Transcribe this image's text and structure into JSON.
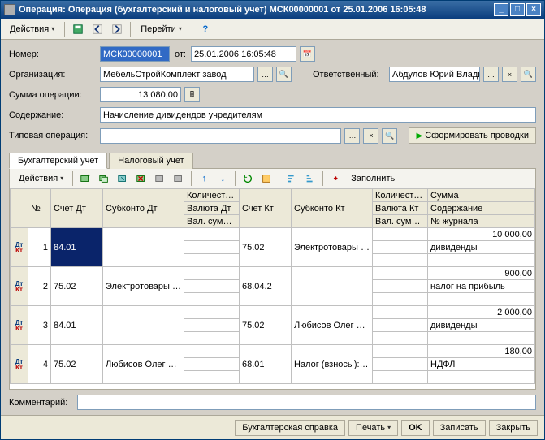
{
  "title": "Операция: Операция (бухгалтерский и налоговый учет) МСК00000001 от 25.01.2006 16:05:48",
  "toolbar": {
    "actions": "Действия",
    "goto": "Перейти",
    "help": "?"
  },
  "fields": {
    "number_label": "Номер:",
    "number_value": "МСК00000001",
    "from_label": "от:",
    "date_value": "25.01.2006 16:05:48",
    "org_label": "Организация:",
    "org_value": "МебельСтройКомплект завод",
    "resp_label": "Ответственный:",
    "resp_value": "Абдулов Юрий Владимирович",
    "sum_label": "Сумма операции:",
    "sum_value": "13 080,00",
    "content_label": "Содержание:",
    "content_value": "Начисление дивидендов учредителям",
    "typical_label": "Типовая операция:",
    "typical_value": "",
    "form_entries": "Сформировать проводки",
    "comment_label": "Комментарий:",
    "comment_value": ""
  },
  "tabs": {
    "acc": "Бухгалтерский учет",
    "tax": "Налоговый учет"
  },
  "innerbar": {
    "actions": "Действия",
    "fill": "Заполнить"
  },
  "headers": {
    "n": "№",
    "acct_dt": "Счет Дт",
    "sub_dt": "Субконто Дт",
    "qty": "Количест…",
    "acct_kt": "Счет Кт",
    "sub_kt": "Субконто Кт",
    "qty2": "Количест…",
    "sum": "Сумма",
    "cur_dt": "Валюта Дт",
    "cur_kt": "Валюта Кт",
    "soder": "Содержание",
    "valsum": "Вал. сумм…",
    "valsum2": "Вал. сумм…",
    "journal": "№ журнала"
  },
  "rows": [
    {
      "n": "1",
      "dt": "84.01",
      "sub_dt": "",
      "kt": "75.02",
      "sub_kt": "Электротовары …",
      "sum": "10 000,00",
      "soder": "дивиденды",
      "journal": ""
    },
    {
      "n": "2",
      "dt": "75.02",
      "sub_dt": "Электротовары …",
      "kt": "68.04.2",
      "sub_kt": "",
      "sum": "900,00",
      "soder": "налог на прибыль",
      "journal": ""
    },
    {
      "n": "3",
      "dt": "84.01",
      "sub_dt": "",
      "kt": "75.02",
      "sub_kt": "Любисов Олег м…",
      "sum": "2 000,00",
      "soder": "дивиденды",
      "journal": ""
    },
    {
      "n": "4",
      "dt": "75.02",
      "sub_dt": "Любисов Олег м…",
      "kt": "68.01",
      "sub_kt": "Налог (взносы): …",
      "sum": "180,00",
      "soder": "НДФЛ",
      "journal": ""
    }
  ],
  "footer": {
    "spravka": "Бухгалтерская справка",
    "print": "Печать",
    "ok": "OK",
    "save": "Записать",
    "close": "Закрыть"
  }
}
